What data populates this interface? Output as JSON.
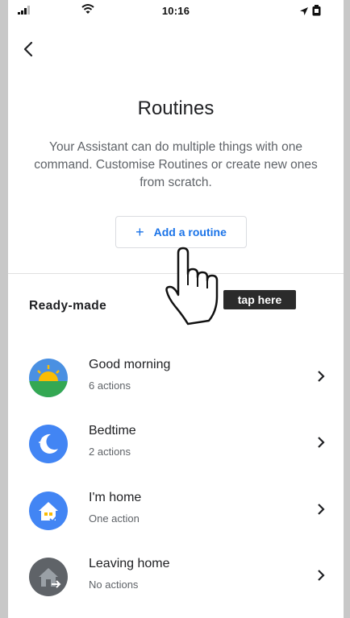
{
  "status_bar": {
    "time": "10:16"
  },
  "page": {
    "title": "Routines",
    "description": "Your Assistant can do multiple things with one command. Customise Routines or create new ones from scratch."
  },
  "add_button": {
    "icon": "+",
    "label": "Add a routine"
  },
  "overlay": {
    "tap_label": "tap here"
  },
  "section_title": "Ready-made",
  "routines": [
    {
      "name": "Good morning",
      "sub": "6 actions",
      "icon": "sunrise-icon"
    },
    {
      "name": "Bedtime",
      "sub": "2 actions",
      "icon": "moon-icon"
    },
    {
      "name": "I'm home",
      "sub": "One action",
      "icon": "home-arrive-icon"
    },
    {
      "name": "Leaving home",
      "sub": "No actions",
      "icon": "home-leave-icon"
    }
  ],
  "colors": {
    "accent": "#1a73e8",
    "divider": "#e0e0e0"
  }
}
